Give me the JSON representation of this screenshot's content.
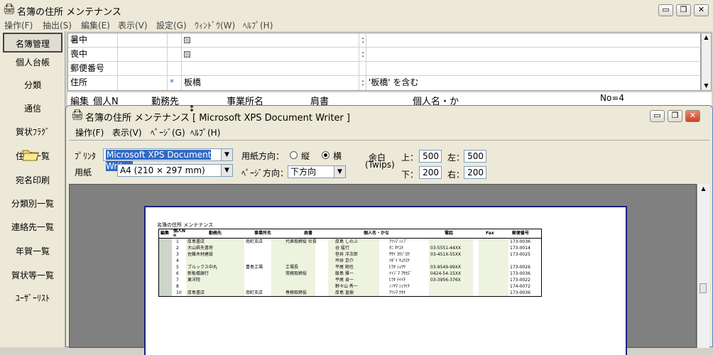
{
  "main_window": {
    "title": "名簿の住所 メンテナンス",
    "menu": [
      "操作(F)",
      "抽出(S)",
      "編集(E)",
      "表示(V)",
      "設定(G)",
      "ｳｨﾝﾄﾞｳ(W)",
      "ﾍﾙﾌﾟ(H)"
    ],
    "controls": {
      "minimize": "▭",
      "restore": "❐",
      "close": "✕"
    }
  },
  "sidebar": {
    "items": [
      "名簿管理",
      "個人台帳",
      "分類",
      "通信",
      "賀状ﾌﾗｸﾞ",
      "住所一覧",
      "宛名印刷",
      "分類別一覧",
      "連絡先一覧",
      "年賀一覧",
      "賀状等一覧",
      "ﾕｰｻﾞｰﾘｽﾄ"
    ],
    "active_index": 0
  },
  "criteria": {
    "rows": [
      {
        "field": "暑中",
        "flag": "",
        "value_type": "checkbox",
        "value": "",
        "colon": ":",
        "desc": ""
      },
      {
        "field": "喪中",
        "flag": "",
        "value_type": "checkbox",
        "value": "",
        "colon": ":",
        "desc": ""
      },
      {
        "field": "郵便番号",
        "flag": "",
        "value_type": "text",
        "value": "",
        "colon": "",
        "desc": ""
      },
      {
        "field": "住所",
        "flag": "*",
        "value_type": "text",
        "value": "板橋",
        "colon": ":",
        "desc": "'板橋' を含む"
      }
    ]
  },
  "list_header": {
    "cols": [
      "編集",
      "個人N",
      "勤務先",
      "事業所名",
      "肩書",
      "個人名・か"
    ],
    "record": "No=4"
  },
  "dialog": {
    "title": "名簿の住所 メンテナンス [ Microsoft XPS Document Writer ]",
    "menu": [
      "操作(F)",
      "表示(V)",
      "ﾍﾟｰｼﾞ(G)",
      "ﾍﾙﾌﾟ(H)"
    ],
    "printer_label": "ﾌﾟﾘﾝﾀ",
    "printer_value": "Microsoft XPS Document Writer",
    "paper_label": "用紙",
    "paper_value": "A4 (210 × 297 mm)",
    "orientation_label": "用紙方向：",
    "orientation_portrait": "縦",
    "orientation_landscape": "横",
    "orientation_selected": "landscape",
    "page_dir_label": "ﾍﾟｰｼﾞ方向：",
    "page_dir_value": "下方向",
    "margin_label": "余白",
    "margin_unit": "(Twips)",
    "margin_top_label": "上：",
    "margin_top": "500",
    "margin_left_label": "左：",
    "margin_left": "500",
    "margin_bottom_label": "下：",
    "margin_bottom": "200",
    "margin_right_label": "右：",
    "margin_right": "200"
  },
  "preview": {
    "title": "名簿の住所 メンテナンス",
    "headers": [
      "編集",
      "個人N o",
      "勤務先",
      "事業所名",
      "肩書",
      "個人名・かな",
      "電話",
      "Fax",
      "郵便番号"
    ],
    "rows": [
      {
        "edit": "",
        "no": "1",
        "company": "厚島書店",
        "office": "南町支店",
        "title": "代表取締役 社長",
        "name": "厚島 しのぶ",
        "kana": "ｱﾂｼﾏ ｼﾉﾌﾞ",
        "tel": "",
        "fax": "",
        "zip": "173-0036"
      },
      {
        "edit": "",
        "no": "2",
        "company": "大山県先書房",
        "office": "",
        "title": "",
        "name": "谷 猛行",
        "kana": "ﾀﾆ ﾀｹﾕｷ",
        "tel": "03-5551-44XX",
        "fax": "",
        "zip": "173-0014"
      },
      {
        "edit": "",
        "no": "3",
        "company": "佐藤木材建設",
        "office": "",
        "title": "",
        "name": "笹井 洋次郎",
        "kana": "ｻｻｲ ﾖｳｼﾞﾛｳ",
        "tel": "03-451X-55XX",
        "fax": "",
        "zip": "173-0025"
      },
      {
        "edit": "",
        "no": "4",
        "company": "",
        "office": "",
        "title": "",
        "name": "坪井 京介",
        "kana": "ﾂﾎﾞｲ ｷｮｳｽｹ",
        "tel": "",
        "fax": "",
        "zip": ""
      },
      {
        "edit": "",
        "no": "5",
        "company": "ブルックス中丸",
        "office": "豊島工場",
        "title": "工場長",
        "name": "平尾 翔也",
        "kana": "ﾋﾗｵ ｼｮｳﾔ",
        "tel": "03-9549-99XX",
        "fax": "",
        "zip": "173-0026"
      },
      {
        "edit": "",
        "no": "6",
        "company": "新板橋銀行",
        "office": "",
        "title": "常務取締役",
        "name": "飯島 雅一",
        "kana": "ｲｲｼﾞﾏ ﾏｻｶｽﾞ",
        "tel": "0424-54-15XX",
        "fax": "",
        "zip": "173-0036"
      },
      {
        "edit": "",
        "no": "7",
        "company": "東洋院",
        "office": "",
        "title": "",
        "name": "平尾 貞一",
        "kana": "ﾋﾗｵ ﾃｲｲﾁ",
        "tel": "03-3956-376X",
        "fax": "",
        "zip": "173-0022"
      },
      {
        "edit": "",
        "no": "8",
        "company": "",
        "office": "",
        "title": "",
        "name": "野々山 秀一",
        "kana": "ﾉﾉﾔﾏ ｼｭｳｲﾁ",
        "tel": "",
        "fax": "",
        "zip": "174-0072"
      },
      {
        "edit": "",
        "no": "10",
        "company": "厚島書店",
        "office": "南町支店",
        "title": "専務取締役",
        "name": "厚島 直樹",
        "kana": "ｱﾂｼﾏ ﾅｵｷ",
        "tel": "",
        "fax": "",
        "zip": "173-0036"
      }
    ]
  },
  "colors": {
    "accent": "#316ac5",
    "paper_border": "#1a237e",
    "preview_bg": "#808080"
  }
}
